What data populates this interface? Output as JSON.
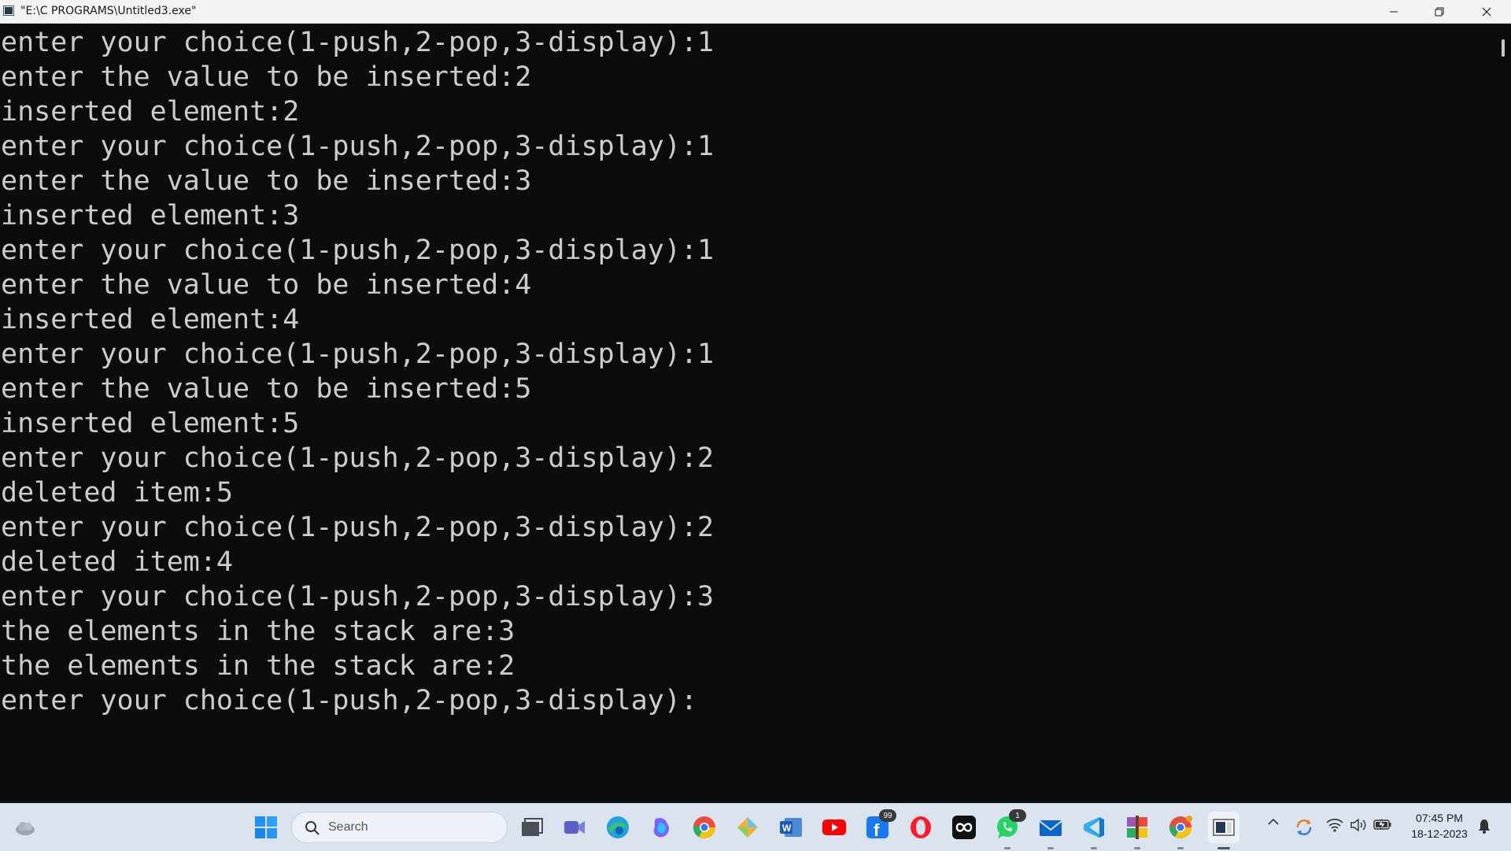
{
  "window": {
    "title": "\"E:\\C PROGRAMS\\Untitled3.exe\""
  },
  "console": {
    "lines": [
      "enter your choice(1-push,2-pop,3-display):1",
      "enter the value to be inserted:2",
      "inserted element:2",
      "enter your choice(1-push,2-pop,3-display):1",
      "enter the value to be inserted:3",
      "inserted element:3",
      "enter your choice(1-push,2-pop,3-display):1",
      "enter the value to be inserted:4",
      "inserted element:4",
      "enter your choice(1-push,2-pop,3-display):1",
      "enter the value to be inserted:5",
      "inserted element:5",
      "enter your choice(1-push,2-pop,3-display):2",
      "deleted item:5",
      "enter your choice(1-push,2-pop,3-display):2",
      "deleted item:4",
      "enter your choice(1-push,2-pop,3-display):3",
      "the elements in the stack are:3",
      "the elements in the stack are:2",
      "enter your choice(1-push,2-pop,3-display):"
    ]
  },
  "taskbar": {
    "search_placeholder": "Search",
    "facebook_badge": "99",
    "whatsapp_badge": "1",
    "time": "07:45 PM",
    "date": "18-12-2023",
    "apps": [
      "windows-start",
      "task-view",
      "meet",
      "edge",
      "copilot",
      "chrome",
      "gem",
      "word",
      "youtube",
      "facebook",
      "opera",
      "infinity",
      "whatsapp",
      "mail",
      "vscode",
      "winrar",
      "chrome-alt",
      "console"
    ]
  },
  "colors": {
    "console_bg": "#0c0c0c",
    "console_text": "#cccccc",
    "titlebar_bg": "#f3f3f3",
    "taskbar_bg": "#dbe3ee"
  }
}
